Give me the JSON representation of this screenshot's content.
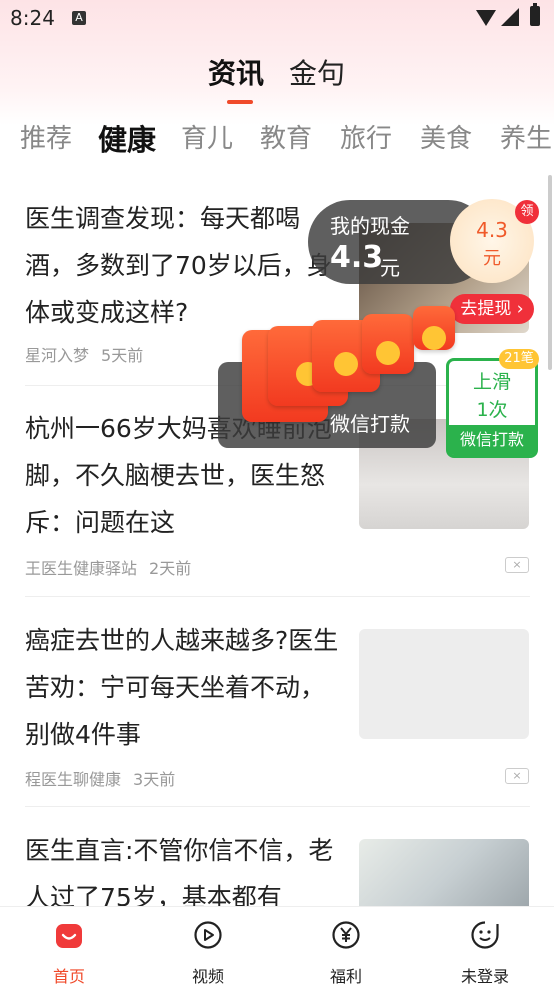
{
  "status_bar": {
    "time": "8:24",
    "notification_icon": "A"
  },
  "top_tabs": [
    {
      "label": "资讯",
      "active": true
    },
    {
      "label": "金句",
      "active": false
    }
  ],
  "categories": [
    "推荐",
    "健康",
    "育儿",
    "教育",
    "旅行",
    "美食",
    "养生"
  ],
  "active_category": "健康",
  "articles": [
    {
      "title": "医生调查发现：每天都喝酒，多数到了70岁以后，身体或变成这样?",
      "source": "星河入梦",
      "time": "5天前"
    },
    {
      "title": "杭州一66岁大妈喜欢睡前泡脚，不久脑梗去世，医生怒斥：问题在这",
      "source": "王医生健康驿站",
      "time": "2天前",
      "close": "×"
    },
    {
      "title": "癌症去世的人越来越多?医生苦劝：宁可每天坐着不动，别做4件事",
      "source": "程医生聊健康",
      "time": "3天前",
      "close": "×"
    },
    {
      "title": "医生直言:不管你信不信，老人过了75岁，基本都有"
    }
  ],
  "cash_widget": {
    "label": "我的现金",
    "amount": "4.3",
    "unit": "元",
    "coin_amount": "4.3",
    "coin_unit": "元",
    "claim_badge": "领",
    "withdraw_label": "去提现 ›"
  },
  "wechat_popup": {
    "text": "微信打款",
    "count_badge": "21笔",
    "card_line1": "上滑",
    "card_line2": "1次",
    "card_footer": "微信打款"
  },
  "bottom_nav": [
    {
      "label": "首页",
      "icon": "home-icon",
      "active": true
    },
    {
      "label": "视频",
      "icon": "video-play-icon",
      "active": false
    },
    {
      "label": "福利",
      "icon": "yuan-coin-icon",
      "active": false
    },
    {
      "label": "未登录",
      "icon": "user-face-icon",
      "active": false
    }
  ],
  "colors": {
    "accent": "#f04a2a",
    "wechat_green": "#2bb24c",
    "red_envelope": "#f23a20"
  }
}
